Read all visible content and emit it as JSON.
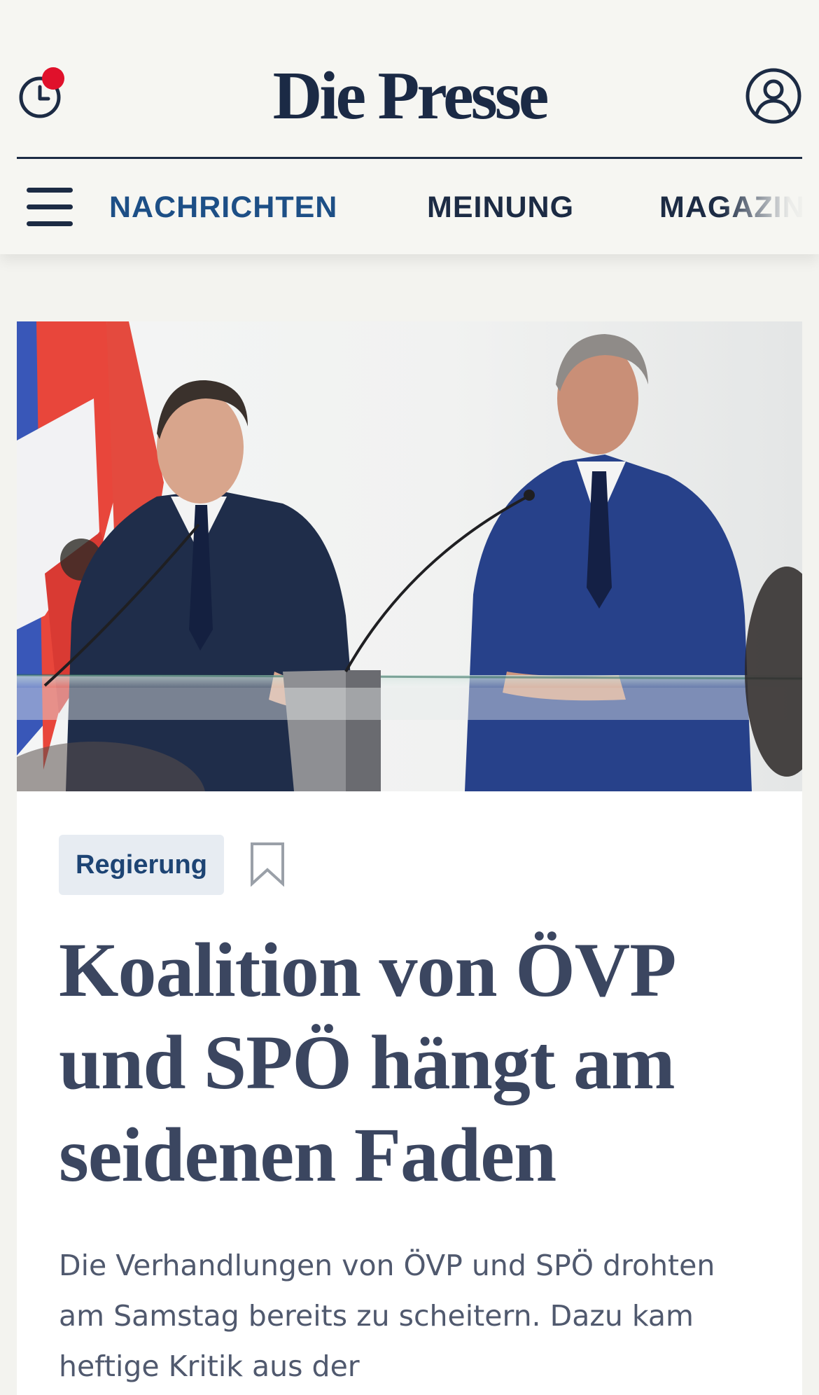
{
  "header": {
    "brand": "Die Presse",
    "history_icon": "clock-icon",
    "notification_color": "#e0112b",
    "account_icon": "user-circle-icon",
    "menu_icon": "hamburger-menu-icon"
  },
  "nav": {
    "items": [
      {
        "label": "NACHRICHTEN",
        "active": true
      },
      {
        "label": "MEINUNG",
        "active": false
      },
      {
        "label": "MAGAZIN",
        "active": false
      }
    ]
  },
  "article": {
    "image_description_icon": "press-conference-photo",
    "tag": "Regierung",
    "bookmark_icon": "bookmark-icon",
    "headline": "Koalition von ÖVP und SPÖ hängt am seidenen Faden",
    "lead": "Die Verhandlungen von ÖVP und SPÖ drohten am Samstag bereits zu scheitern. Dazu kam heftige Kritik aus der"
  },
  "colors": {
    "brand_navy": "#1b2a45",
    "nav_active": "#1d4f86",
    "tag_background": "#e7ecf2",
    "headline": "#3b4660"
  }
}
